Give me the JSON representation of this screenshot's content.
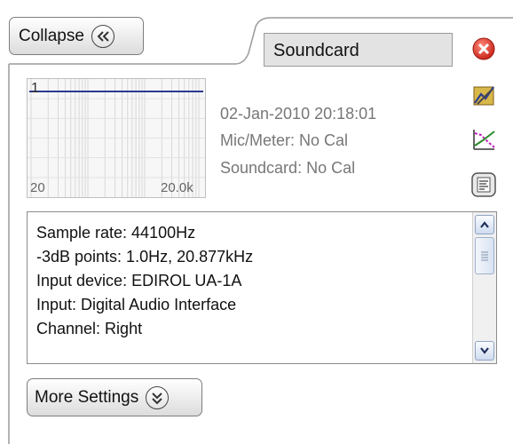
{
  "header": {
    "collapse_label": "Collapse",
    "name_value": "Soundcard"
  },
  "graph": {
    "y_label": "1",
    "x_start_label": "20",
    "x_end_label": "20.0k",
    "trace_color": "#2b3a8f"
  },
  "info": {
    "timestamp": "02-Jan-2010 20:18:01",
    "mic_meter_cal": "Mic/Meter: No Cal",
    "soundcard_cal": "Soundcard: No Cal"
  },
  "details": {
    "lines": [
      "Sample rate: 44100Hz",
      "-3dB points: 1.0Hz,  20.877kHz",
      "Input device: EDIROL UA-1A",
      "Input: Digital Audio Interface",
      "Channel: Right"
    ]
  },
  "footer": {
    "more_settings_label": "More Settings"
  },
  "icons": {
    "close": "close-icon",
    "calibrate": "calibrate-icon",
    "response": "response-curve-icon",
    "notes": "notes-icon",
    "close_color": "#d93a2f"
  }
}
